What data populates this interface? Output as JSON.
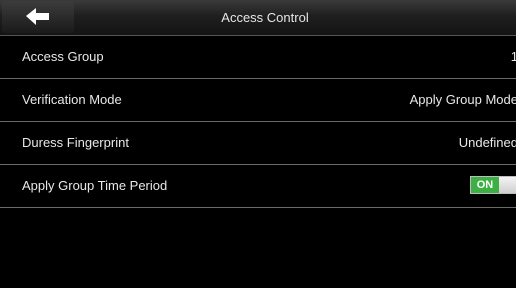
{
  "header": {
    "title": "Access Control",
    "back_icon": "arrow-left-icon"
  },
  "settings": {
    "items": [
      {
        "label": "Access Group",
        "value": "1"
      },
      {
        "label": "Verification Mode",
        "value": "Apply Group Mode"
      },
      {
        "label": "Duress Fingerprint",
        "value": "Undefined"
      },
      {
        "label": "Apply Group Time Period",
        "toggle_label": "ON",
        "toggle_state": true
      }
    ]
  },
  "colors": {
    "toggle_on": "#3cb043",
    "background": "#000000",
    "divider": "#6a6a6a"
  }
}
